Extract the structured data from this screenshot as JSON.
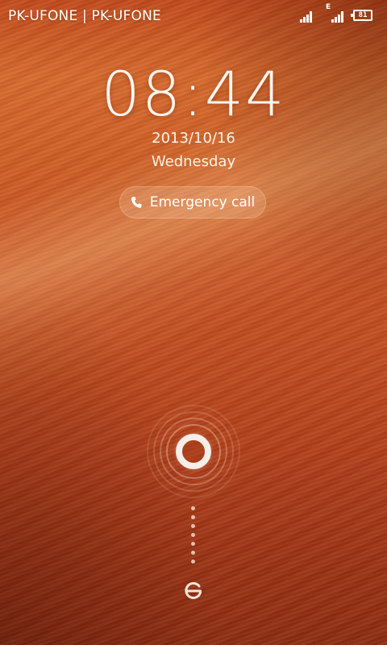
{
  "status_bar": {
    "carrier": "PK-UFONE | PK-UFONE",
    "network_type": "E",
    "battery_level": "81"
  },
  "lockscreen": {
    "time": "08:44",
    "date": "2013/10/16",
    "weekday": "Wednesday",
    "emergency_call_label": "Emergency call"
  },
  "icons": {
    "signal": "signal-icon",
    "battery": "battery-icon",
    "phone": "phone-icon",
    "unlock_handle": "unlock-ring-icon",
    "camera_target": "camera-target-icon"
  },
  "colors": {
    "wallpaper_top": "#c24a1c",
    "wallpaper_mid": "#d66a2d",
    "wallpaper_bottom": "#8a2a10",
    "text": "#ffffff"
  }
}
